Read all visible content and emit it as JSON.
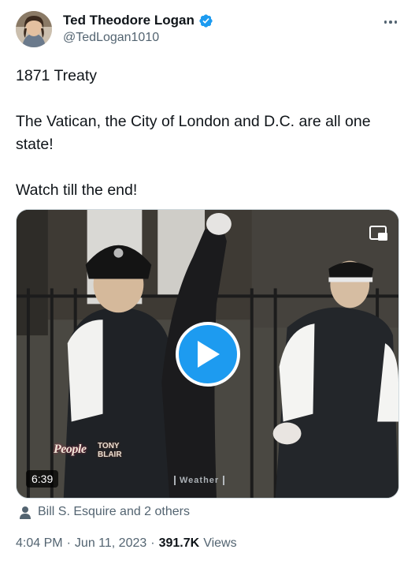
{
  "author": {
    "display_name": "Ted Theodore Logan",
    "handle": "@TedLogan1010",
    "verified": true,
    "avatar_icon": "avatar-image"
  },
  "tweet": {
    "lines": [
      "1871 Treaty",
      "The Vatican, the City of London and D.C. are all one state!",
      "Watch till the end!"
    ]
  },
  "media": {
    "type": "video",
    "duration": "6:39",
    "play_icon": "play-icon",
    "pip_icon": "picture-in-picture-icon",
    "overlay_logo_text": "People",
    "overlay_name_line1": "TONY",
    "overlay_name_line2": "BLAIR",
    "overlay_weather_text": "Weather"
  },
  "social_context": {
    "icon": "person-icon",
    "text": "Bill S. Esquire and 2 others"
  },
  "meta": {
    "time": "4:04 PM",
    "separator": "·",
    "date": "Jun 11, 2023",
    "views_count": "391.7K",
    "views_label": "Views"
  },
  "colors": {
    "accent": "#1d9bf0",
    "text_primary": "#0f1419",
    "text_secondary": "#536471"
  }
}
